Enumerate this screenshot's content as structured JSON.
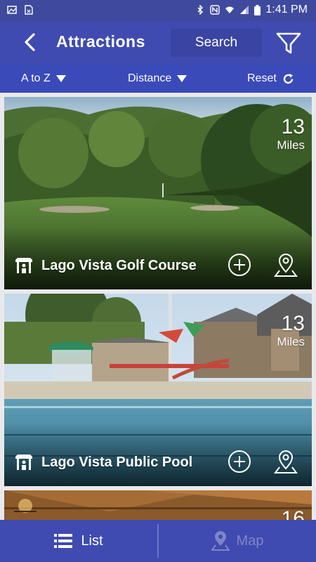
{
  "status": {
    "time": "1:41 PM"
  },
  "header": {
    "title": "Attractions",
    "search_label": "Search"
  },
  "sortbar": {
    "sort_az": "A to Z",
    "sort_distance": "Distance",
    "reset": "Reset"
  },
  "cards": [
    {
      "title": "Lago Vista Golf Course",
      "distance": "13",
      "unit": "Miles"
    },
    {
      "title": "Lago Vista Public Pool",
      "distance": "13",
      "unit": "Miles"
    },
    {
      "title": "",
      "distance": "16",
      "unit": ""
    }
  ],
  "bottom_nav": {
    "list": "List",
    "map": "Map"
  },
  "colors": {
    "primary": "#3f4bb0",
    "sortbar": "#3a4ab8",
    "map_inactive": "#7d86c7"
  }
}
